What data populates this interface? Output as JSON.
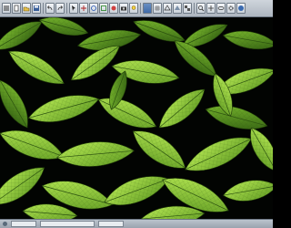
{
  "window": {
    "title": ""
  },
  "toolbar": {
    "buttons": [
      {
        "name": "menu-icon"
      },
      {
        "name": "new-icon"
      },
      {
        "name": "open-icon"
      },
      {
        "name": "save-icon"
      },
      {
        "name": "undo-icon"
      },
      {
        "name": "redo-icon"
      },
      {
        "name": "select-icon"
      },
      {
        "name": "move-icon"
      },
      {
        "name": "rotate-icon"
      },
      {
        "name": "scale-icon"
      },
      {
        "name": "render-icon"
      },
      {
        "name": "camera-icon"
      },
      {
        "name": "light-icon"
      },
      {
        "name": "grid-icon"
      },
      {
        "name": "wireframe-icon"
      },
      {
        "name": "shaded-icon"
      },
      {
        "name": "texture-icon"
      },
      {
        "name": "zoom-icon"
      },
      {
        "name": "pan-icon"
      },
      {
        "name": "orbit-icon"
      },
      {
        "name": "settings-icon"
      },
      {
        "name": "help-icon"
      }
    ]
  },
  "viewport": {
    "background": "#020402",
    "leaf_color_light": "#a9e04a",
    "leaf_color_dark": "#4f8a1c"
  },
  "statusbar": {
    "fields": 4
  }
}
